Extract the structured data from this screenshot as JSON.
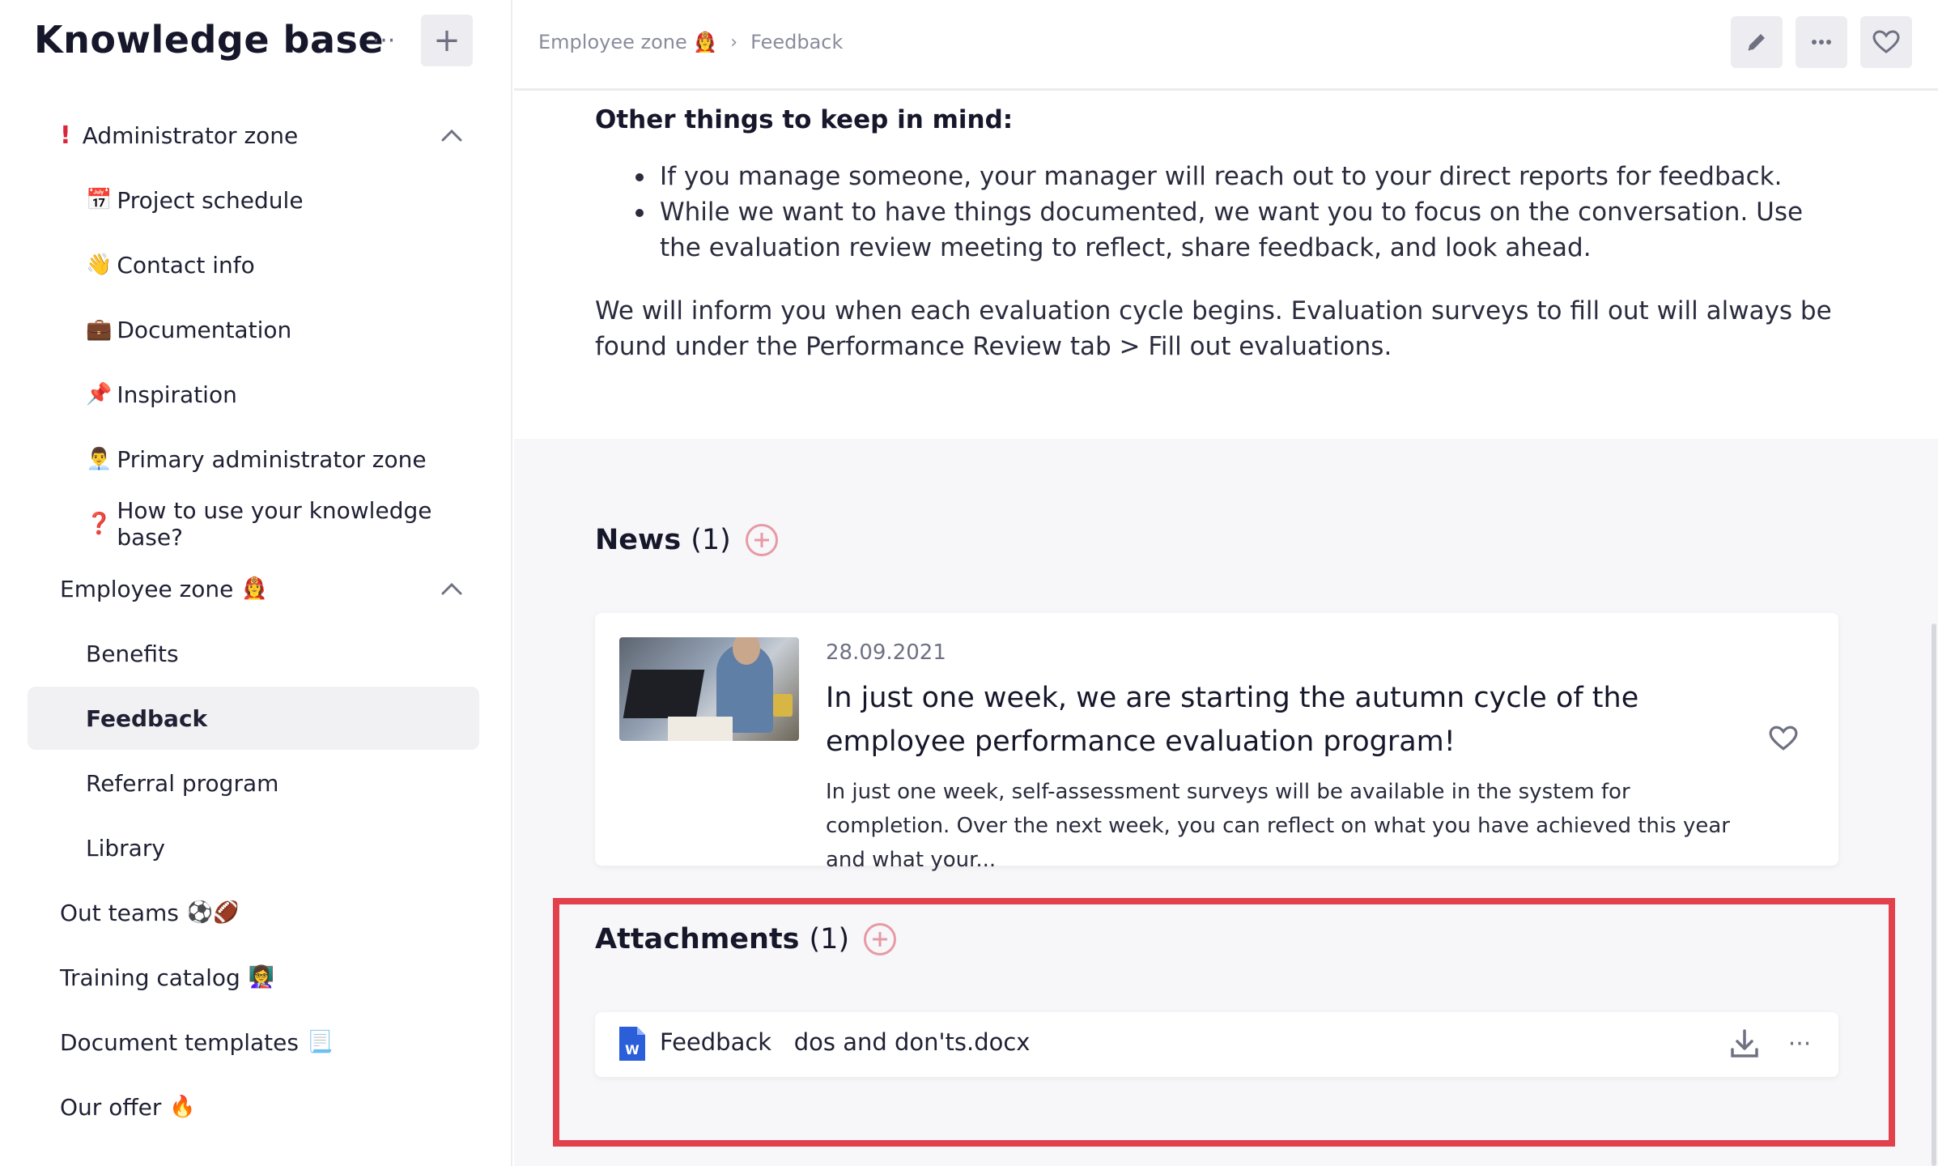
{
  "sidebar": {
    "title": "Knowledge base",
    "more_label": "···",
    "add_label": "+",
    "items": [
      {
        "emoji": "!",
        "label": "Administrator zone"
      },
      {
        "emoji": "📅",
        "label": "Project schedule"
      },
      {
        "emoji": "👋",
        "label": "Contact info"
      },
      {
        "emoji": "💼",
        "label": "Documentation"
      },
      {
        "emoji": "📌",
        "label": "Inspiration"
      },
      {
        "emoji": "👨‍💼",
        "label": "Primary administrator zone"
      },
      {
        "emoji": "❓",
        "label": "How to use your knowledge base?"
      },
      {
        "emoji": "👩‍🚒",
        "label": "Employee zone"
      },
      {
        "emoji": "",
        "label": "Benefits"
      },
      {
        "emoji": "",
        "label": "Feedback"
      },
      {
        "emoji": "",
        "label": "Referral program"
      },
      {
        "emoji": "",
        "label": "Library"
      },
      {
        "emoji": "⚽🏈",
        "label": "Out teams"
      },
      {
        "emoji": "👩‍🏫",
        "label": "Training catalog"
      },
      {
        "emoji": "📃",
        "label": "Document templates"
      },
      {
        "emoji": "🔥",
        "label": "Our offer"
      }
    ]
  },
  "breadcrumb": {
    "parent": "Employee zone",
    "parent_emoji": "👩‍🚒",
    "separator": "›",
    "current": "Feedback"
  },
  "article": {
    "heading": "Other things to keep in mind:",
    "bullets": [
      "If you manage someone, your manager will reach out to your direct reports for feedback.",
      "While we want to have things documented, we want you to focus on the conversation. Use the evaluation review meeting to reflect, share feedback, and look ahead."
    ],
    "paragraph": "We will inform you when each evaluation cycle begins. Evaluation surveys to fill out will always be found under the Performance Review tab > Fill out evaluations."
  },
  "news": {
    "title": "News",
    "count": "(1)",
    "item": {
      "date": "28.09.2021",
      "title": "In just one week, we are starting the autumn cycle of the employee performance evaluation program!",
      "description": "In just one week, self-assessment surveys will be available in the system for completion. Over the next week, you can reflect on what you have achieved this year and what your..."
    }
  },
  "attachments": {
    "title": "Attachments",
    "count": "(1)",
    "file_name": "Feedback   dos and don'ts.docx",
    "more_label": "···"
  },
  "colors": {
    "highlight": "#e2414b",
    "accent_pink": "#e79aa5",
    "word_blue": "#2b5fd9"
  }
}
